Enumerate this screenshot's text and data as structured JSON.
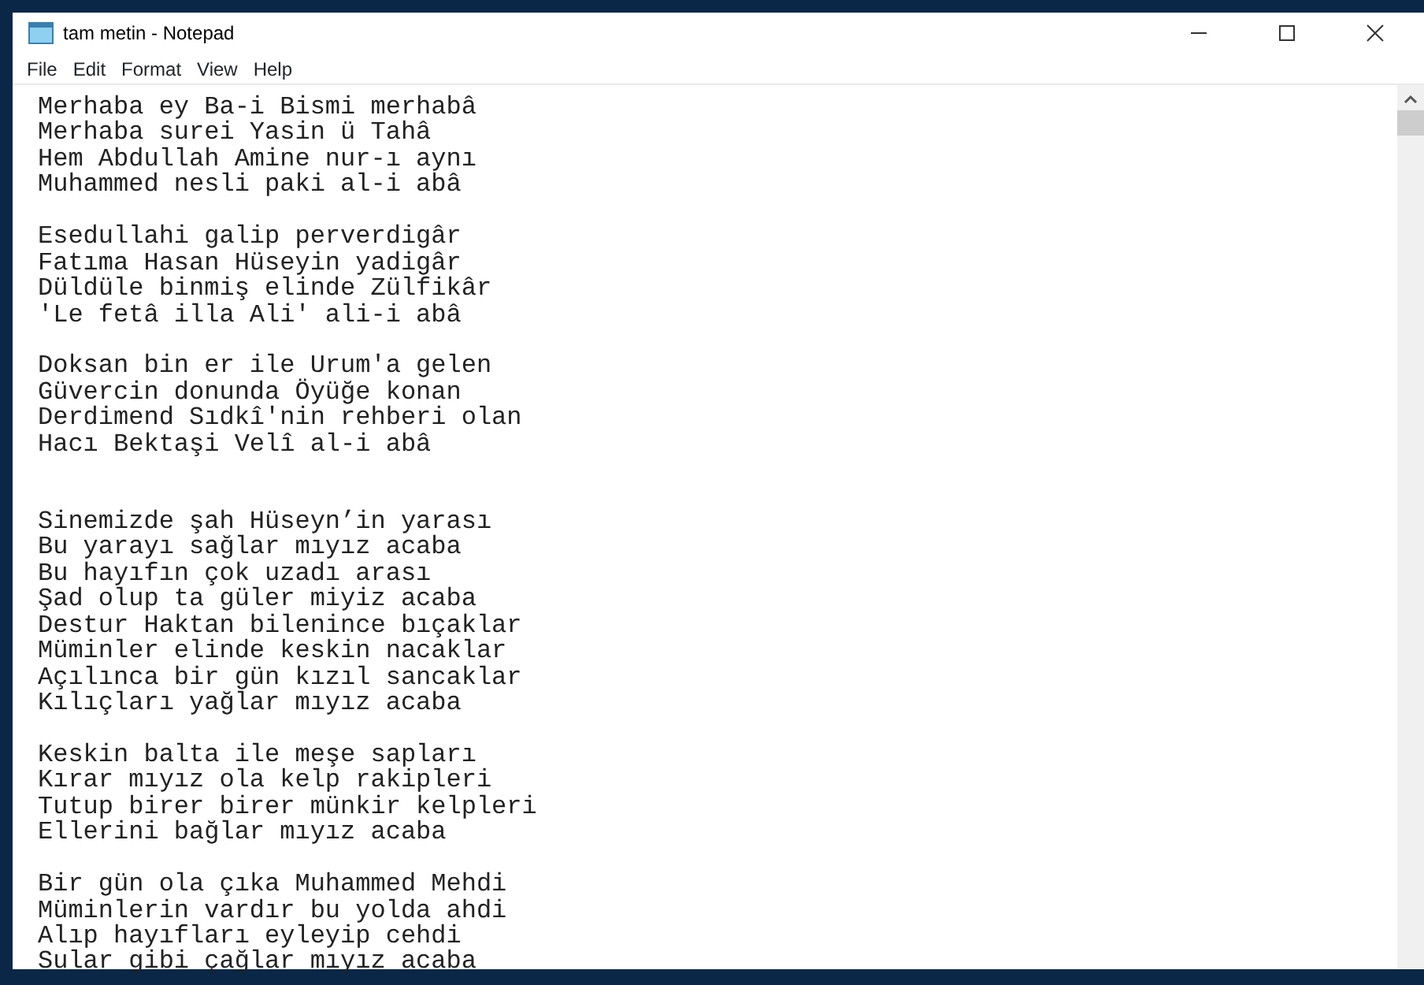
{
  "window": {
    "title": "tam metin - Notepad"
  },
  "menu": [
    "File",
    "Edit",
    "Format",
    "View",
    "Help"
  ],
  "stanzas": [
    {
      "kind": "opening",
      "lines": [
        "Merhaba ey Ba-i Bismi merhabâ",
        "Merhaba surei Yasin ü Tahâ",
        "Hem Abdullah Amine nur-ı aynı",
        "Muhammed nesli paki al-i abâ"
      ]
    },
    {
      "kind": "verse",
      "lines": [
        "Esedullahi galip perverdigâr",
        "Fatıma Hasan Hüseyin yadigâr",
        "Düldüle binmiş elinde Zülfikâr",
        "'Le fetâ illa Ali' ali-i abâ"
      ]
    },
    {
      "kind": "verse",
      "lines": [
        "Doksan bin er ile Urum'a gelen",
        "Güvercin donunda Öyüğe konan",
        "Derdimend Sıdkî'nin rehberi olan",
        "Hacı Bektaşi Velî al-i abâ"
      ]
    },
    {
      "kind": "section",
      "lines": [
        "Sinemizde şah Hüseyn’in yarası",
        "Bu yarayı sağlar mıyız acaba",
        "Bu hayıfın çok uzadı arası",
        "Şad olup ta güler miyiz acaba",
        "Destur Haktan bilenince bıçaklar",
        "Müminler elinde keskin nacaklar",
        "Açılınca bir gün kızıl sancaklar",
        "Kılıçları yağlar mıyız acaba"
      ]
    },
    {
      "kind": "verse",
      "lines": [
        "Keskin balta ile meşe sapları",
        "Kırar mıyız ola kelp rakipleri",
        "Tutup birer birer münkir kelpleri",
        "Ellerini bağlar mıyız acaba"
      ]
    },
    {
      "kind": "verse",
      "lines": [
        "Bir gün ola çıka Muhammed Mehdi",
        "Müminlerin vardır bu yolda ahdi",
        "Alıp hayıfları eyleyip cehdi",
        "Sular gibi çağlar mıyız acaba"
      ]
    }
  ]
}
